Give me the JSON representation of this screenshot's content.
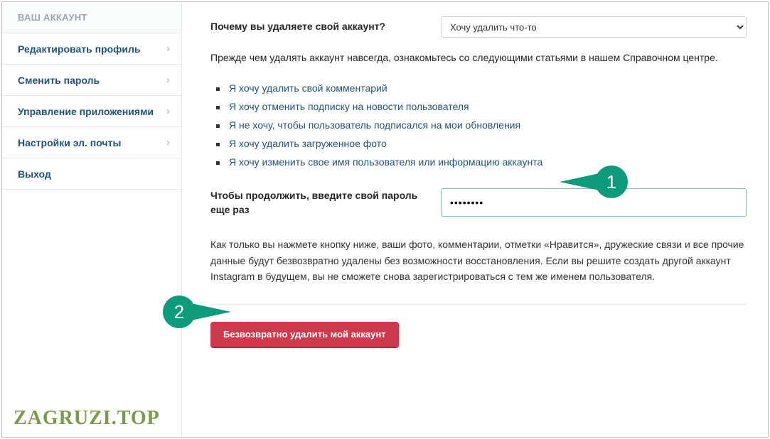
{
  "sidebar": {
    "header": "ВАШ АККАУНТ",
    "items": [
      {
        "label": "Редактировать профиль",
        "chevron": true
      },
      {
        "label": "Сменить пароль",
        "chevron": true
      },
      {
        "label": "Управление приложениями",
        "chevron": true
      },
      {
        "label": "Настройки эл. почты",
        "chevron": true
      },
      {
        "label": "Выход",
        "chevron": false
      }
    ]
  },
  "main": {
    "reason_label": "Почему вы удаляете свой аккаунт?",
    "reason_selected": "Хочу удалить что-то",
    "intro": "Прежде чем удалять аккаунт навсегда, ознакомьтесь со следующими статьями в нашем Справочном центре.",
    "help_links": [
      "Я хочу удалить свой комментарий",
      "Я хочу отменить подписку на новости пользователя",
      "Я не хочу, чтобы пользователь подписался на мои обновления",
      "Я хочу удалить загруженное фото",
      "Я хочу изменить свое имя пользователя или информацию аккаунта"
    ],
    "password_label": "Чтобы продолжить, введите свой пароль еще раз",
    "password_value": "••••••••",
    "warning": "Как только вы нажмете кнопку ниже, ваши фото, комментарии, отметки «Нравится», дружеские связи и все прочие данные будут безвозвратно удалены без возможности восстановления. Если вы решите создать другой аккаунт Instagram в будущем, вы не сможете снова зарегистрироваться с тем же именем пользователя.",
    "delete_button": "Безвозвратно удалить мой аккаунт"
  },
  "callouts": {
    "one": "1",
    "two": "2"
  },
  "watermark": "ZAGRUZI.TOP"
}
